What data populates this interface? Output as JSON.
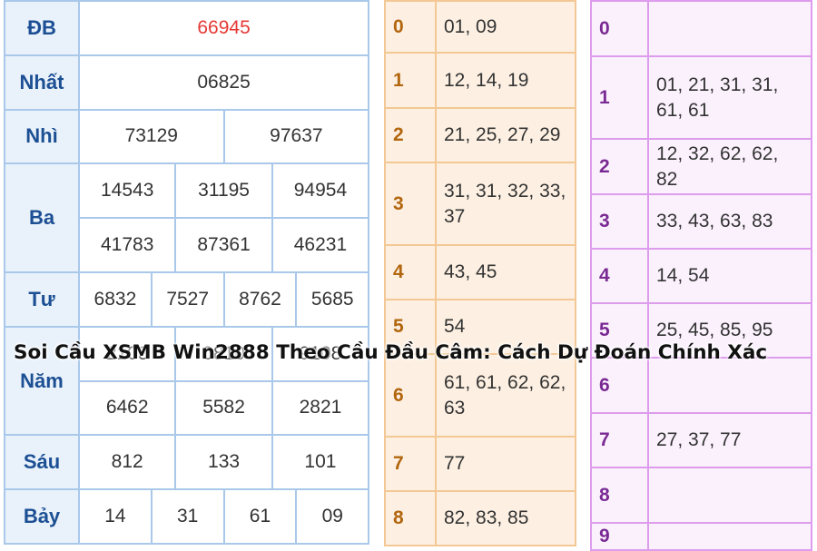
{
  "results": {
    "rows": [
      {
        "label": "ĐB",
        "values": [
          [
            "66945"
          ]
        ]
      },
      {
        "label": "Nhất",
        "values": [
          [
            "06825"
          ]
        ]
      },
      {
        "label": "Nhì",
        "values": [
          [
            "73129",
            "97637"
          ]
        ]
      },
      {
        "label": "Ba",
        "values": [
          [
            "14543",
            "31195",
            "94954"
          ],
          [
            "41783",
            "87361",
            "46231"
          ]
        ]
      },
      {
        "label": "Tư",
        "values": [
          [
            "6832",
            "7527",
            "8762",
            "5685"
          ]
        ]
      },
      {
        "label": "Năm",
        "values": [
          [
            "2103",
            "0810",
            "9108"
          ],
          [
            "6462",
            "5582",
            "2821"
          ]
        ]
      },
      {
        "label": "Sáu",
        "values": [
          [
            "812",
            "133",
            "101"
          ]
        ]
      },
      {
        "label": "Bảy",
        "values": [
          [
            "14",
            "31",
            "61",
            "09"
          ]
        ]
      }
    ],
    "special_color": "#e53935"
  },
  "heads": [
    {
      "digit": "0",
      "values": "01, 09"
    },
    {
      "digit": "1",
      "values": "12, 14, 19"
    },
    {
      "digit": "2",
      "values": "21, 25, 27, 29"
    },
    {
      "digit": "3",
      "values": "31, 31, 32, 33, 37"
    },
    {
      "digit": "4",
      "values": "43, 45"
    },
    {
      "digit": "5",
      "values": "54"
    },
    {
      "digit": "6",
      "values": "61, 61, 62, 62, 63"
    },
    {
      "digit": "7",
      "values": "77"
    },
    {
      "digit": "8",
      "values": "82, 83, 85"
    }
  ],
  "tails": [
    {
      "digit": "0",
      "values": ""
    },
    {
      "digit": "1",
      "values": "01, 21, 31, 31, 61, 61"
    },
    {
      "digit": "2",
      "values": "12, 32, 62, 62, 82"
    },
    {
      "digit": "3",
      "values": "33, 43, 63, 83"
    },
    {
      "digit": "4",
      "values": "14, 54"
    },
    {
      "digit": "5",
      "values": "25, 45, 85, 95"
    },
    {
      "digit": "6",
      "values": ""
    },
    {
      "digit": "7",
      "values": "27, 37, 77"
    },
    {
      "digit": "8",
      "values": ""
    },
    {
      "digit": "9",
      "values": ""
    }
  ],
  "caption": "Soi Cầu XSMB Win2888 Theo Cầu Đầu Câm: Cách Dự Đoán Chính Xác"
}
